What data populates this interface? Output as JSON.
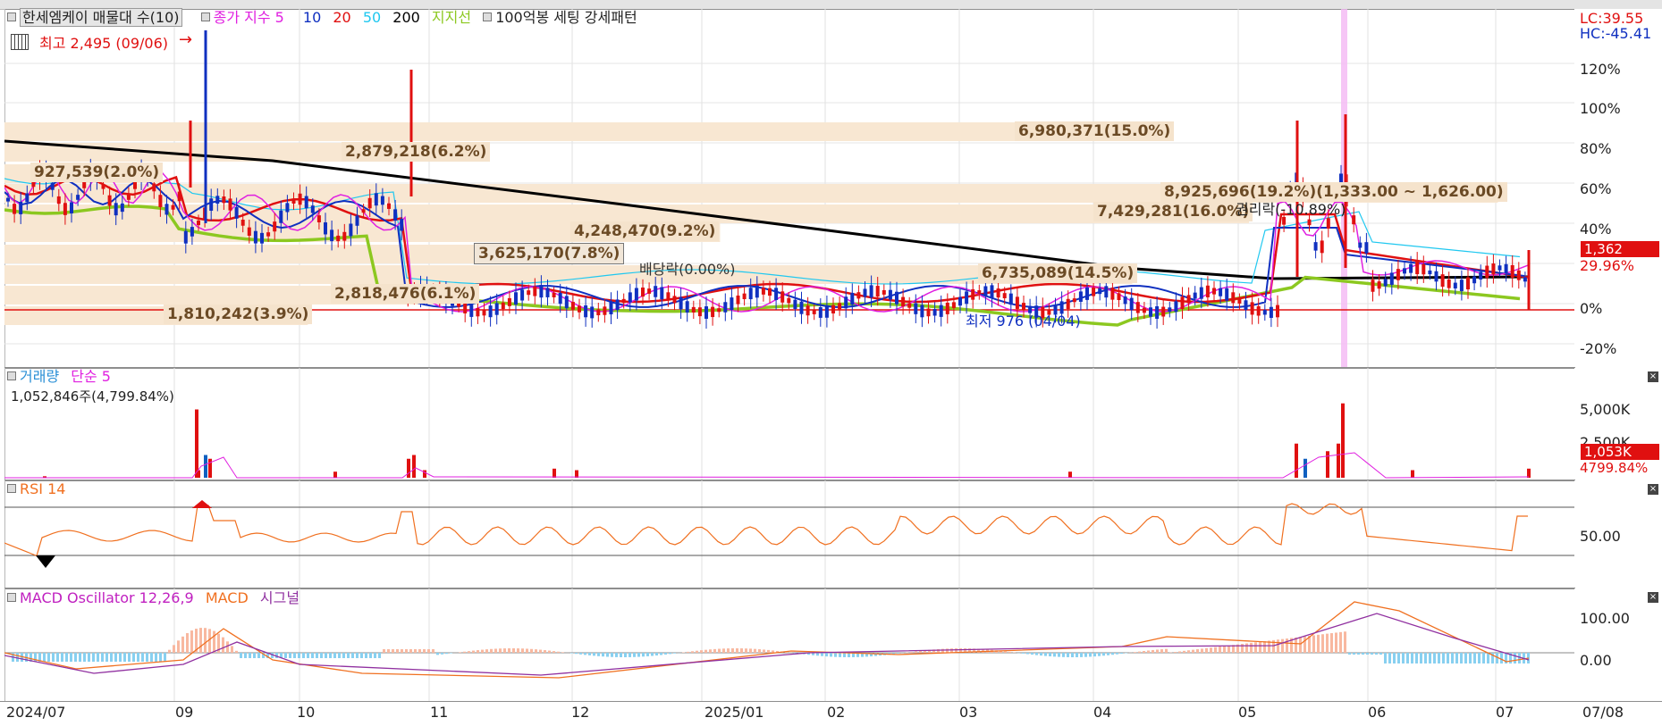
{
  "price_pane": {
    "stock_label": "한세엠케이 매물대 수(10)",
    "ma_label": "종가 지수 5",
    "ma_10": "10",
    "ma_20": "20",
    "ma_50": "50",
    "ma_200": "200",
    "support_label": "지지선",
    "pattern_label": "100억봉 세팅 강세패턴",
    "high_label": "최고 2,495 (09/06)",
    "low_label": "최저 976 (04/04)",
    "lc": "LC:39.55",
    "hc": "HC:-45.41",
    "current_price_tag": "1,362",
    "current_pct_tag": "29.96%",
    "dividend_label": "배당락(0.00%)",
    "rights_label": "권리락(-10.89%)",
    "y_ticks": [
      "120%",
      "100%",
      "80%",
      "60%",
      "40%",
      "20%",
      "0%",
      "-20%"
    ],
    "volume_profile": [
      {
        "label": "6,980,371(15.0%)",
        "pct": 15.0
      },
      {
        "label": "2,879,218(6.2%)",
        "pct": 6.2
      },
      {
        "label": "927,539(2.0%)",
        "pct": 2.0
      },
      {
        "label": "8,925,696(19.2%)(1,333.00 ~ 1,626.00)",
        "pct": 19.2
      },
      {
        "label": "7,429,281(16.0%)",
        "pct": 16.0
      },
      {
        "label": "4,248,470(9.2%)",
        "pct": 9.2
      },
      {
        "label": "3,625,170(7.8%)",
        "pct": 7.8
      },
      {
        "label": "6,735,089(14.5%)",
        "pct": 14.5
      },
      {
        "label": "2,818,476(6.1%)",
        "pct": 6.1
      },
      {
        "label": "1,810,242(3.9%)",
        "pct": 3.9
      }
    ],
    "colors": {
      "ma5": "#e020e0",
      "ma10": "#1030c0",
      "ma20": "#e01010",
      "ma50": "#20c8f0",
      "ma200": "#000000",
      "support": "#8cc820"
    }
  },
  "volume_pane": {
    "label": "거래량",
    "ma_label": "단순 5",
    "value_label": "1,052,846주(4,799.84%)",
    "y_ticks": [
      "5,000K",
      "2,500K"
    ],
    "volume_tag": "1,053K",
    "pct_tag": "4799.84%"
  },
  "rsi_pane": {
    "label": "RSI 14",
    "y_tick": "50.00"
  },
  "macd_pane": {
    "label": "MACD Oscillator 12,26,9",
    "macd_label": "MACD",
    "signal_label": "시그널",
    "y_ticks": [
      "100.00",
      "0.00"
    ]
  },
  "x_axis": [
    "2024/07",
    "09",
    "10",
    "11",
    "12",
    "2025/01",
    "02",
    "03",
    "04",
    "05",
    "06",
    "07",
    "07/08"
  ]
}
